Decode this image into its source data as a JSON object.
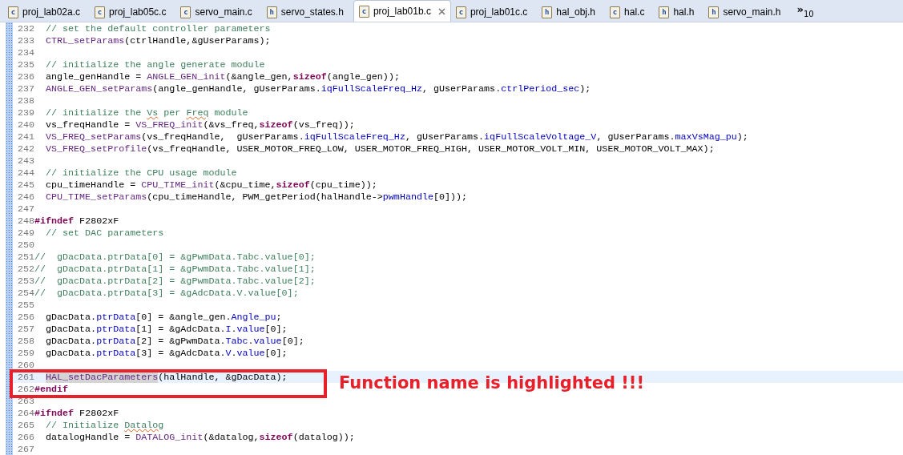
{
  "tabs": [
    {
      "label": "proj_lab02a.c",
      "icon": "c",
      "selected": false
    },
    {
      "label": "proj_lab05c.c",
      "icon": "c",
      "selected": false
    },
    {
      "label": "servo_main.c",
      "icon": "c",
      "selected": false
    },
    {
      "label": "servo_states.h",
      "icon": "h",
      "selected": false
    },
    {
      "label": "proj_lab01b.c",
      "icon": "c",
      "selected": true
    },
    {
      "label": "proj_lab01c.c",
      "icon": "c",
      "selected": false
    },
    {
      "label": "hal_obj.h",
      "icon": "h",
      "selected": false
    },
    {
      "label": "hal.c",
      "icon": "c",
      "selected": false
    },
    {
      "label": "hal.h",
      "icon": "h",
      "selected": false
    },
    {
      "label": "servo_main.h",
      "icon": "h",
      "selected": false
    }
  ],
  "overflow": {
    "symbol": "»",
    "count": "10"
  },
  "annotation": {
    "text": "Function name is highlighted !!!"
  },
  "lines": [
    {
      "number": "232",
      "indented": true,
      "tokens": [
        {
          "text": "// set the default controller parameters",
          "kind": "comment"
        }
      ]
    },
    {
      "number": "233",
      "indented": true,
      "tokens": [
        {
          "text": "CTRL_setParams",
          "kind": "func"
        },
        {
          "text": "(ctrlHandle,&gUserParams);",
          "kind": "plain"
        }
      ]
    },
    {
      "number": "234"
    },
    {
      "number": "235",
      "indented": true,
      "tokens": [
        {
          "text": "// initialize the angle generate module",
          "kind": "comment"
        }
      ]
    },
    {
      "number": "236",
      "indented": true,
      "tokens": [
        {
          "text": "angle_genHandle = ",
          "kind": "plain"
        },
        {
          "text": "ANGLE_GEN_init",
          "kind": "func"
        },
        {
          "text": "(&angle_gen,",
          "kind": "plain"
        },
        {
          "text": "sizeof",
          "kind": "keyword"
        },
        {
          "text": "(angle_gen));",
          "kind": "plain"
        }
      ]
    },
    {
      "number": "237",
      "indented": true,
      "tokens": [
        {
          "text": "ANGLE_GEN_setParams",
          "kind": "func"
        },
        {
          "text": "(angle_genHandle, gUserParams.",
          "kind": "plain"
        },
        {
          "text": "iqFullScaleFreq_Hz",
          "kind": "field"
        },
        {
          "text": ", gUserParams.",
          "kind": "plain"
        },
        {
          "text": "ctrlPeriod_sec",
          "kind": "field"
        },
        {
          "text": ");",
          "kind": "plain"
        }
      ]
    },
    {
      "number": "238"
    },
    {
      "number": "239",
      "indented": true,
      "tokens": [
        {
          "text": "// initialize the ",
          "kind": "comment"
        },
        {
          "text": "Vs",
          "kind": "misspelled"
        },
        {
          "text": " per ",
          "kind": "comment"
        },
        {
          "text": "Freq",
          "kind": "misspelled"
        },
        {
          "text": " module",
          "kind": "comment"
        }
      ]
    },
    {
      "number": "240",
      "indented": true,
      "tokens": [
        {
          "text": "vs_freqHandle = ",
          "kind": "plain"
        },
        {
          "text": "VS_FREQ_init",
          "kind": "func"
        },
        {
          "text": "(&vs_freq,",
          "kind": "plain"
        },
        {
          "text": "sizeof",
          "kind": "keyword"
        },
        {
          "text": "(vs_freq));",
          "kind": "plain"
        }
      ]
    },
    {
      "number": "241",
      "indented": true,
      "tokens": [
        {
          "text": "VS_FREQ_setParams",
          "kind": "func"
        },
        {
          "text": "(vs_freqHandle,  gUserParams.",
          "kind": "plain"
        },
        {
          "text": "iqFullScaleFreq_Hz",
          "kind": "field"
        },
        {
          "text": ", gUserParams.",
          "kind": "plain"
        },
        {
          "text": "iqFullScaleVoltage_V",
          "kind": "field"
        },
        {
          "text": ", gUserParams.",
          "kind": "plain"
        },
        {
          "text": "maxVsMag_pu",
          "kind": "field"
        },
        {
          "text": ");",
          "kind": "plain"
        }
      ]
    },
    {
      "number": "242",
      "indented": true,
      "tokens": [
        {
          "text": "VS_FREQ_setProfile",
          "kind": "func"
        },
        {
          "text": "(vs_freqHandle, USER_MOTOR_FREQ_LOW, USER_MOTOR_FREQ_HIGH, USER_MOTOR_VOLT_MIN, USER_MOTOR_VOLT_MAX);",
          "kind": "plain"
        }
      ]
    },
    {
      "number": "243"
    },
    {
      "number": "244",
      "indented": true,
      "tokens": [
        {
          "text": "// initialize the CPU usage module",
          "kind": "comment"
        }
      ]
    },
    {
      "number": "245",
      "indented": true,
      "tokens": [
        {
          "text": "cpu_timeHandle = ",
          "kind": "plain"
        },
        {
          "text": "CPU_TIME_init",
          "kind": "func"
        },
        {
          "text": "(&cpu_time,",
          "kind": "plain"
        },
        {
          "text": "sizeof",
          "kind": "keyword"
        },
        {
          "text": "(cpu_time));",
          "kind": "plain"
        }
      ]
    },
    {
      "number": "246",
      "indented": true,
      "tokens": [
        {
          "text": "CPU_TIME_setParams",
          "kind": "func"
        },
        {
          "text": "(cpu_timeHandle, PWM_getPeriod(halHandle->",
          "kind": "plain"
        },
        {
          "text": "pwmHandle",
          "kind": "field"
        },
        {
          "text": "[0]));",
          "kind": "plain"
        }
      ]
    },
    {
      "number": "247"
    },
    {
      "number": "248",
      "tokens": [
        {
          "text": "#ifndef",
          "kind": "directive"
        },
        {
          "text": " F2802xF",
          "kind": "plain"
        }
      ]
    },
    {
      "number": "249",
      "indented": true,
      "tokens": [
        {
          "text": "// set DAC parameters",
          "kind": "comment"
        }
      ]
    },
    {
      "number": "250"
    },
    {
      "number": "251",
      "tokens": [
        {
          "text": "//  gDacData.ptrData[0] = &gPwmData.Tabc.value[0];",
          "kind": "comment"
        }
      ]
    },
    {
      "number": "252",
      "tokens": [
        {
          "text": "//  gDacData.ptrData[1] = &gPwmData.Tabc.value[1];",
          "kind": "comment"
        }
      ]
    },
    {
      "number": "253",
      "tokens": [
        {
          "text": "//  gDacData.ptrData[2] = &gPwmData.Tabc.value[2];",
          "kind": "comment"
        }
      ]
    },
    {
      "number": "254",
      "tokens": [
        {
          "text": "//  gDacData.ptrData[3] = &gAdcData.V.value[0];",
          "kind": "comment"
        }
      ]
    },
    {
      "number": "255"
    },
    {
      "number": "256",
      "indented": true,
      "tokens": [
        {
          "text": "gDacData.",
          "kind": "plain"
        },
        {
          "text": "ptrData",
          "kind": "field"
        },
        {
          "text": "[0] = &angle_gen.",
          "kind": "plain"
        },
        {
          "text": "Angle_pu",
          "kind": "field"
        },
        {
          "text": ";",
          "kind": "plain"
        }
      ]
    },
    {
      "number": "257",
      "indented": true,
      "tokens": [
        {
          "text": "gDacData.",
          "kind": "plain"
        },
        {
          "text": "ptrData",
          "kind": "field"
        },
        {
          "text": "[1] = &gAdcData.",
          "kind": "plain"
        },
        {
          "text": "I",
          "kind": "field"
        },
        {
          "text": ".",
          "kind": "plain"
        },
        {
          "text": "value",
          "kind": "field"
        },
        {
          "text": "[0];",
          "kind": "plain"
        }
      ]
    },
    {
      "number": "258",
      "indented": true,
      "tokens": [
        {
          "text": "gDacData.",
          "kind": "plain"
        },
        {
          "text": "ptrData",
          "kind": "field"
        },
        {
          "text": "[2] = &gPwmData.",
          "kind": "plain"
        },
        {
          "text": "Tabc",
          "kind": "field"
        },
        {
          "text": ".",
          "kind": "plain"
        },
        {
          "text": "value",
          "kind": "field"
        },
        {
          "text": "[0];",
          "kind": "plain"
        }
      ]
    },
    {
      "number": "259",
      "indented": true,
      "tokens": [
        {
          "text": "gDacData.",
          "kind": "plain"
        },
        {
          "text": "ptrData",
          "kind": "field"
        },
        {
          "text": "[3] = &gAdcData.",
          "kind": "plain"
        },
        {
          "text": "V",
          "kind": "field"
        },
        {
          "text": ".",
          "kind": "plain"
        },
        {
          "text": "value",
          "kind": "field"
        },
        {
          "text": "[0];",
          "kind": "plain"
        }
      ]
    },
    {
      "number": "260"
    },
    {
      "number": "261",
      "current": true,
      "boxed": true,
      "indented": true,
      "tokens": [
        {
          "text": "HAL_setDacParameters",
          "kind": "func",
          "marked": true
        },
        {
          "text": "(halHandle, &gDacData);",
          "kind": "plain"
        }
      ]
    },
    {
      "number": "262",
      "boxed": true,
      "tokens": [
        {
          "text": "#endif",
          "kind": "directive"
        }
      ]
    },
    {
      "number": "263"
    },
    {
      "number": "264",
      "tokens": [
        {
          "text": "#ifndef",
          "kind": "directive"
        },
        {
          "text": " F2802xF",
          "kind": "plain"
        }
      ]
    },
    {
      "number": "265",
      "indented": true,
      "tokens": [
        {
          "text": "// Initialize ",
          "kind": "comment"
        },
        {
          "text": "Datalog",
          "kind": "misspelled"
        }
      ]
    },
    {
      "number": "266",
      "indented": true,
      "tokens": [
        {
          "text": "datalogHandle = ",
          "kind": "plain"
        },
        {
          "text": "DATALOG_init",
          "kind": "func"
        },
        {
          "text": "(&datalog,",
          "kind": "plain"
        },
        {
          "text": "sizeof",
          "kind": "keyword"
        },
        {
          "text": "(datalog));",
          "kind": "plain"
        }
      ]
    },
    {
      "number": "267"
    }
  ]
}
